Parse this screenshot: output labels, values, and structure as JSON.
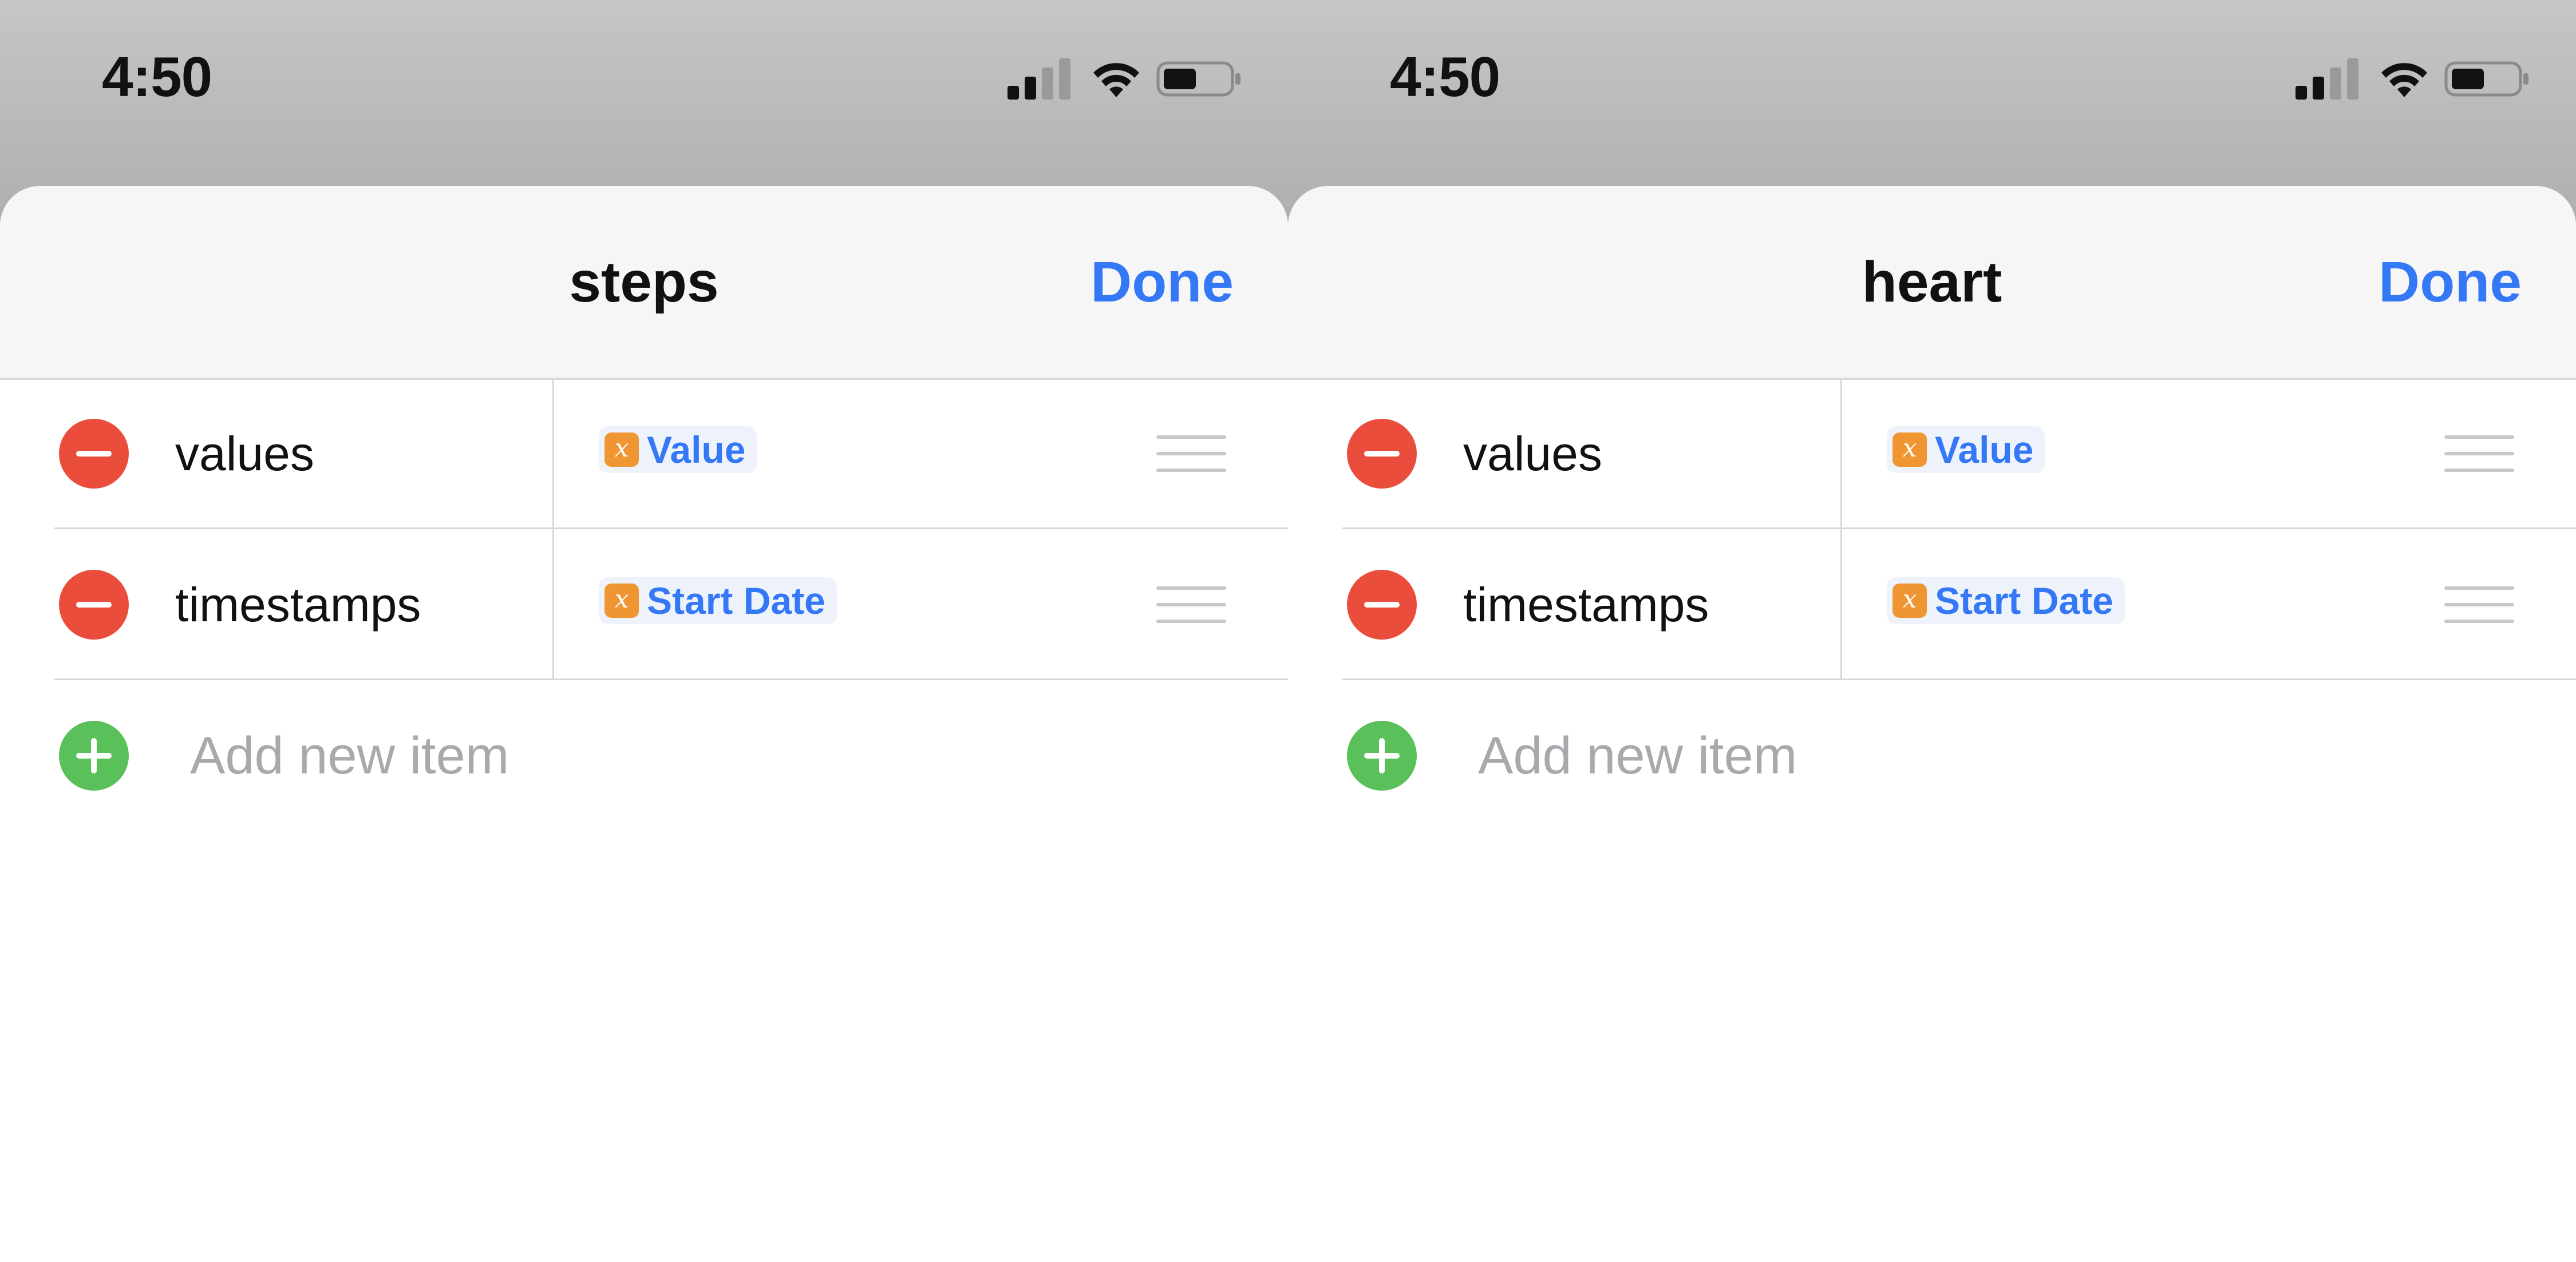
{
  "panels": [
    {
      "status": {
        "time": "4:50"
      },
      "title": "steps",
      "done_label": "Done",
      "rows": [
        {
          "key": "values",
          "token_icon": "x",
          "token_text": "Value"
        },
        {
          "key": "timestamps",
          "token_icon": "x",
          "token_text": "Start Date"
        }
      ],
      "add_placeholder": "Add new item"
    },
    {
      "status": {
        "time": "4:50"
      },
      "title": "heart",
      "done_label": "Done",
      "rows": [
        {
          "key": "values",
          "token_icon": "x",
          "token_text": "Value"
        },
        {
          "key": "timestamps",
          "token_icon": "x",
          "token_text": "Start Date"
        }
      ],
      "add_placeholder": "Add new item"
    }
  ],
  "icons": {
    "status": [
      "cellular-signal-icon",
      "wifi-icon",
      "battery-icon"
    ],
    "row_delete": "minus-circle-icon",
    "row_reorder": "drag-handle-icon",
    "variable": "variable-icon",
    "add": "plus-circle-icon"
  },
  "colors": {
    "accent": "#3478f6",
    "delete": "#eb4d3d",
    "add": "#5ac05a",
    "variable_icon": "#ef9632",
    "placeholder": "#a8a8ad"
  }
}
